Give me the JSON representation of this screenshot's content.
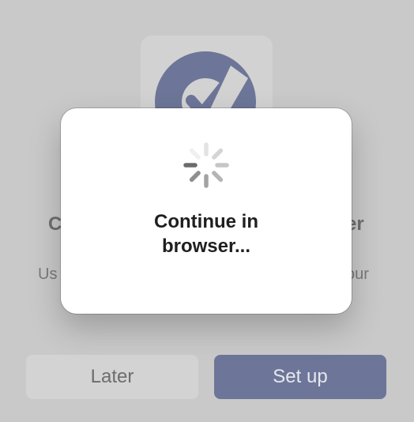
{
  "background": {
    "heading_left_fragment": "C",
    "heading_right_fragment": "er",
    "sub_left_fragment": "Us",
    "sub_right_fragment": "our",
    "icon": "checkmark-badge-icon"
  },
  "buttons": {
    "later_label": "Later",
    "setup_label": "Set up"
  },
  "modal": {
    "spinner_icon": "spinner-icon",
    "message_line1": "Continue in",
    "message_line2": "browser..."
  },
  "colors": {
    "accent": "#6d7698",
    "overlay": "#c9c9c9",
    "modal_bg": "#ffffff"
  }
}
